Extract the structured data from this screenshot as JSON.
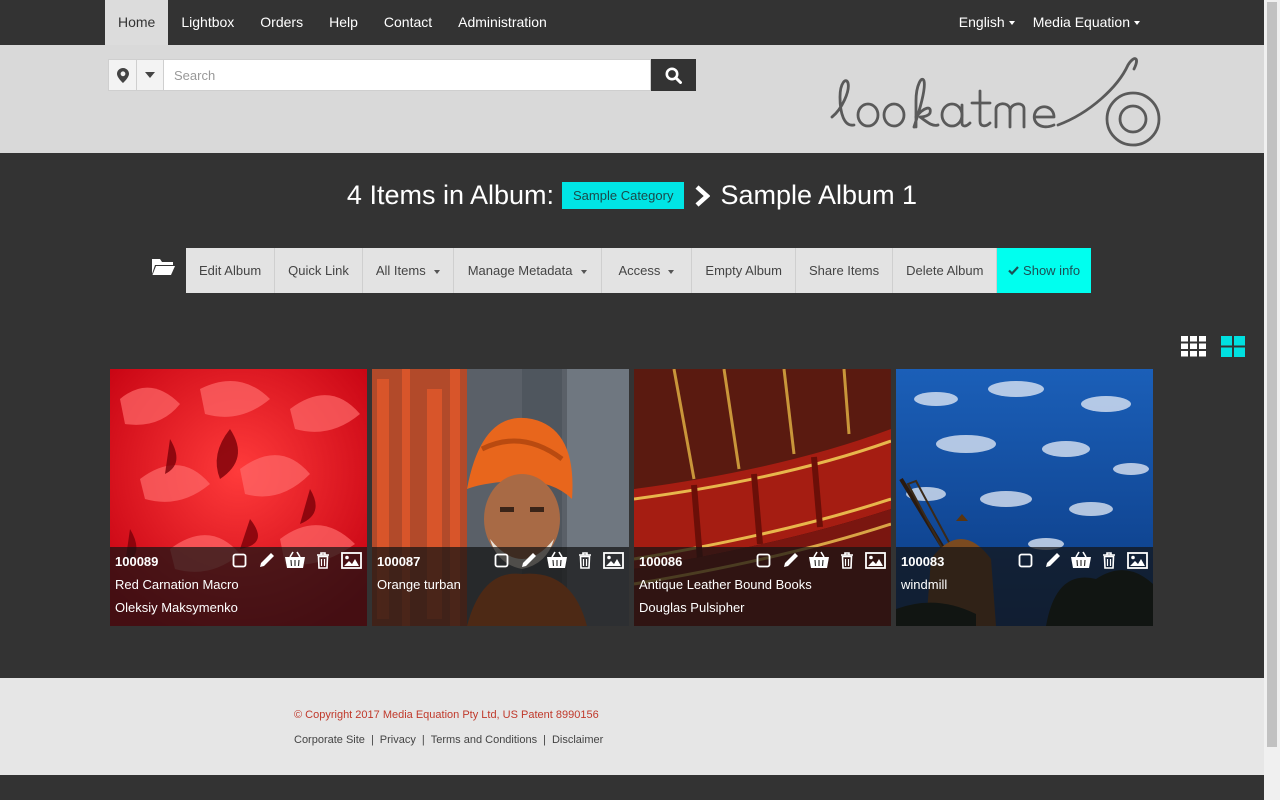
{
  "nav": {
    "items": [
      {
        "label": "Home"
      },
      {
        "label": "Lightbox"
      },
      {
        "label": "Orders"
      },
      {
        "label": "Help"
      },
      {
        "label": "Contact"
      },
      {
        "label": "Administration"
      }
    ],
    "active_index": 0,
    "language": "English",
    "account": "Media Equation"
  },
  "search": {
    "placeholder": "Search",
    "value": ""
  },
  "brand": {
    "logo_icon": "lookatme-logo"
  },
  "album": {
    "count_text": "4 Items in Album:",
    "category": "Sample Category",
    "name": "Sample Album 1"
  },
  "toolbar": {
    "edit_album": "Edit Album",
    "quick_link": "Quick Link",
    "all_items": "All Items",
    "manage_metadata": "Manage Metadata",
    "access": "Access",
    "empty_album": "Empty Album",
    "share_items": "Share Items",
    "delete_album": "Delete Album",
    "show_info": "Show info"
  },
  "items": [
    {
      "id": "100089",
      "title": "Red Carnation Macro",
      "author": "Oleksiy Maksymenko"
    },
    {
      "id": "100087",
      "title": "Orange turban",
      "author": ""
    },
    {
      "id": "100086",
      "title": "Antique Leather Bound Books",
      "author": "Douglas Pulsipher"
    },
    {
      "id": "100083",
      "title": "windmill",
      "author": ""
    }
  ],
  "footer": {
    "copyright": "© Copyright 2017 Media Equation Pty Ltd, US Patent 8990156",
    "links": [
      "Corporate Site",
      "Privacy",
      "Terms and Conditions",
      "Disclaimer"
    ]
  },
  "colors": {
    "accent": "#00ffef",
    "dark": "#333333",
    "header": "#d9d9d9",
    "copyright": "#c0392b"
  }
}
